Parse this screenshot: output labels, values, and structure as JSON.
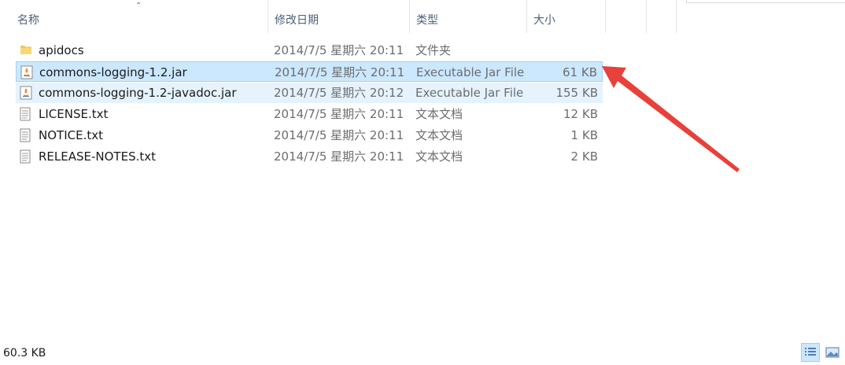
{
  "columns": {
    "name": "名称",
    "date": "修改日期",
    "type": "类型",
    "size": "大小"
  },
  "files": [
    {
      "name": "apidocs",
      "date": "2014/7/5 星期六 20:11",
      "type": "文件夹",
      "size": "",
      "icon": "folder-icon",
      "state": "normal"
    },
    {
      "name": "commons-logging-1.2.jar",
      "date": "2014/7/5 星期六 20:11",
      "type": "Executable Jar File",
      "size": "61 KB",
      "icon": "java-jar-icon",
      "state": "selected"
    },
    {
      "name": "commons-logging-1.2-javadoc.jar",
      "date": "2014/7/5 星期六 20:12",
      "type": "Executable Jar File",
      "size": "155 KB",
      "icon": "java-jar-icon",
      "state": "hover"
    },
    {
      "name": "LICENSE.txt",
      "date": "2014/7/5 星期六 20:11",
      "type": "文本文档",
      "size": "12 KB",
      "icon": "text-file-icon",
      "state": "normal"
    },
    {
      "name": "NOTICE.txt",
      "date": "2014/7/5 星期六 20:11",
      "type": "文本文档",
      "size": "1 KB",
      "icon": "text-file-icon",
      "state": "normal"
    },
    {
      "name": "RELEASE-NOTES.txt",
      "date": "2014/7/5 星期六 20:11",
      "type": "文本文档",
      "size": "2 KB",
      "icon": "text-file-icon",
      "state": "normal"
    }
  ],
  "status": {
    "selection_size": "60.3 KB"
  },
  "colors": {
    "selected_bg": "#cce8ff",
    "hover_bg": "#e5f3ff",
    "annotation_arrow": "#e8403a"
  }
}
